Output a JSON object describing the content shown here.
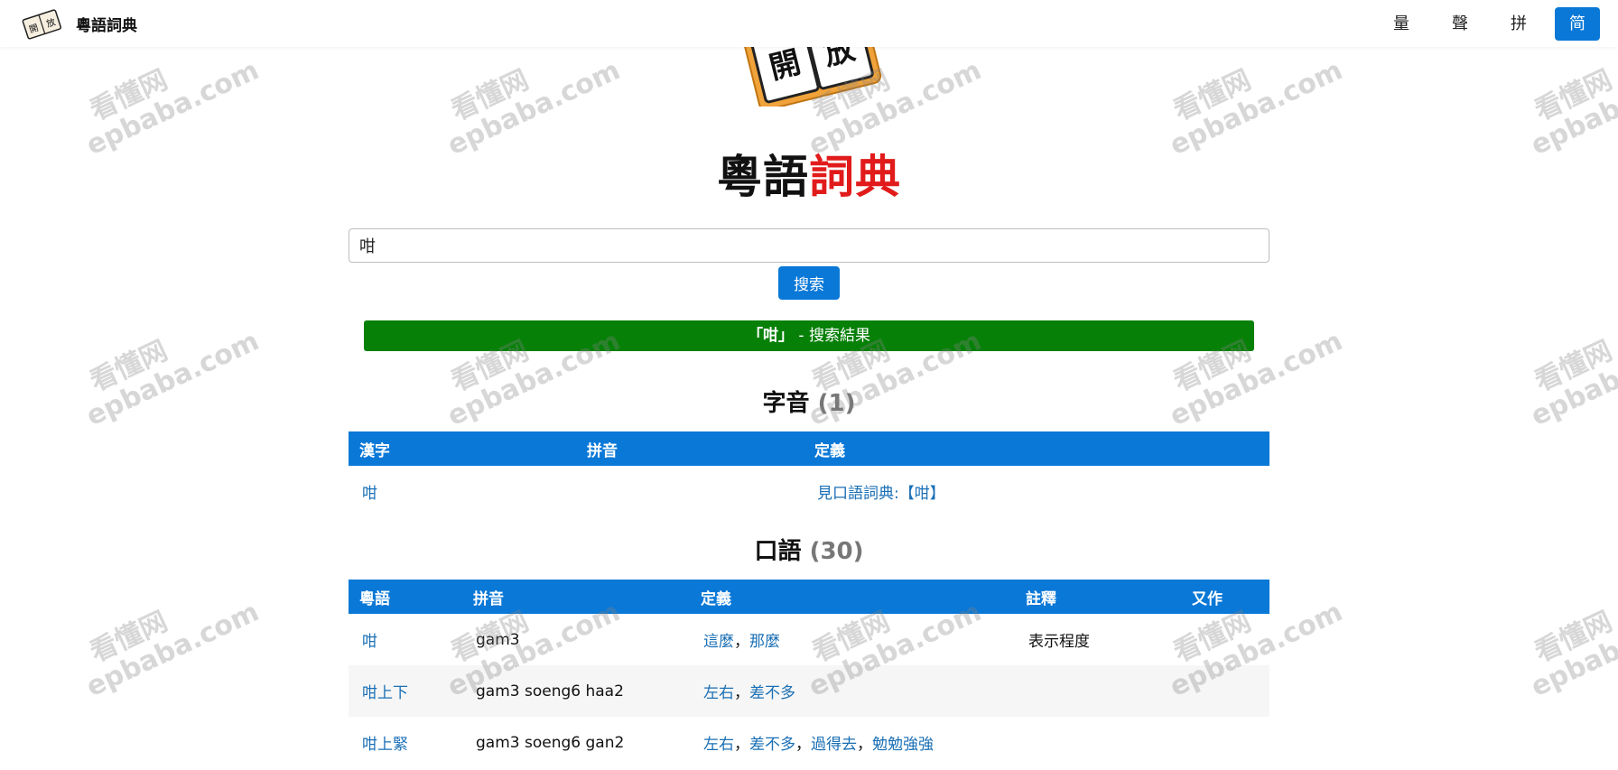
{
  "nav": {
    "brand_title": "粵語詞典",
    "logo_chars": [
      "開",
      "放"
    ],
    "links": [
      "量",
      "聲",
      "拼",
      "简"
    ]
  },
  "hero": {
    "logo_chars": [
      "開",
      "放"
    ],
    "title_black": "粵語",
    "title_red": "詞典"
  },
  "search": {
    "value": "咁",
    "button_label": "搜索"
  },
  "banner": {
    "query": "「咁」",
    "suffix": " - 搜索結果"
  },
  "char_section": {
    "title": "字音",
    "count": "(1)",
    "headers": [
      "漢字",
      "拼音",
      "定義"
    ],
    "rows": [
      {
        "char": "咁",
        "pinyin": "",
        "definition": "見口語詞典:【咁】"
      }
    ]
  },
  "colloquial_section": {
    "title": "口語",
    "count": "(30)",
    "headers": [
      "粵語",
      "拼音",
      "定義",
      "註釋",
      "又作"
    ],
    "rows": [
      {
        "word": "咁",
        "pinyin": "gam3",
        "definitions": [
          "這麼",
          "那麼"
        ],
        "note": "表示程度",
        "alt": ""
      },
      {
        "word": "咁上下",
        "pinyin": "gam3 soeng6 haa2",
        "definitions": [
          "左右",
          "差不多"
        ],
        "note": "",
        "alt": ""
      },
      {
        "word": "咁上緊",
        "pinyin": "gam3 soeng6 gan2",
        "definitions": [
          "左右",
          "差不多",
          "過得去",
          "勉勉強強"
        ],
        "note": "",
        "alt": ""
      }
    ],
    "separator": "，"
  },
  "watermark": {
    "cn": "看懂网",
    "en": "epbaba.com"
  },
  "colors": {
    "accent": "#0a78d7",
    "banner_green": "#078008",
    "title_red": "#e11b1b",
    "link": "#1a6fb5"
  }
}
